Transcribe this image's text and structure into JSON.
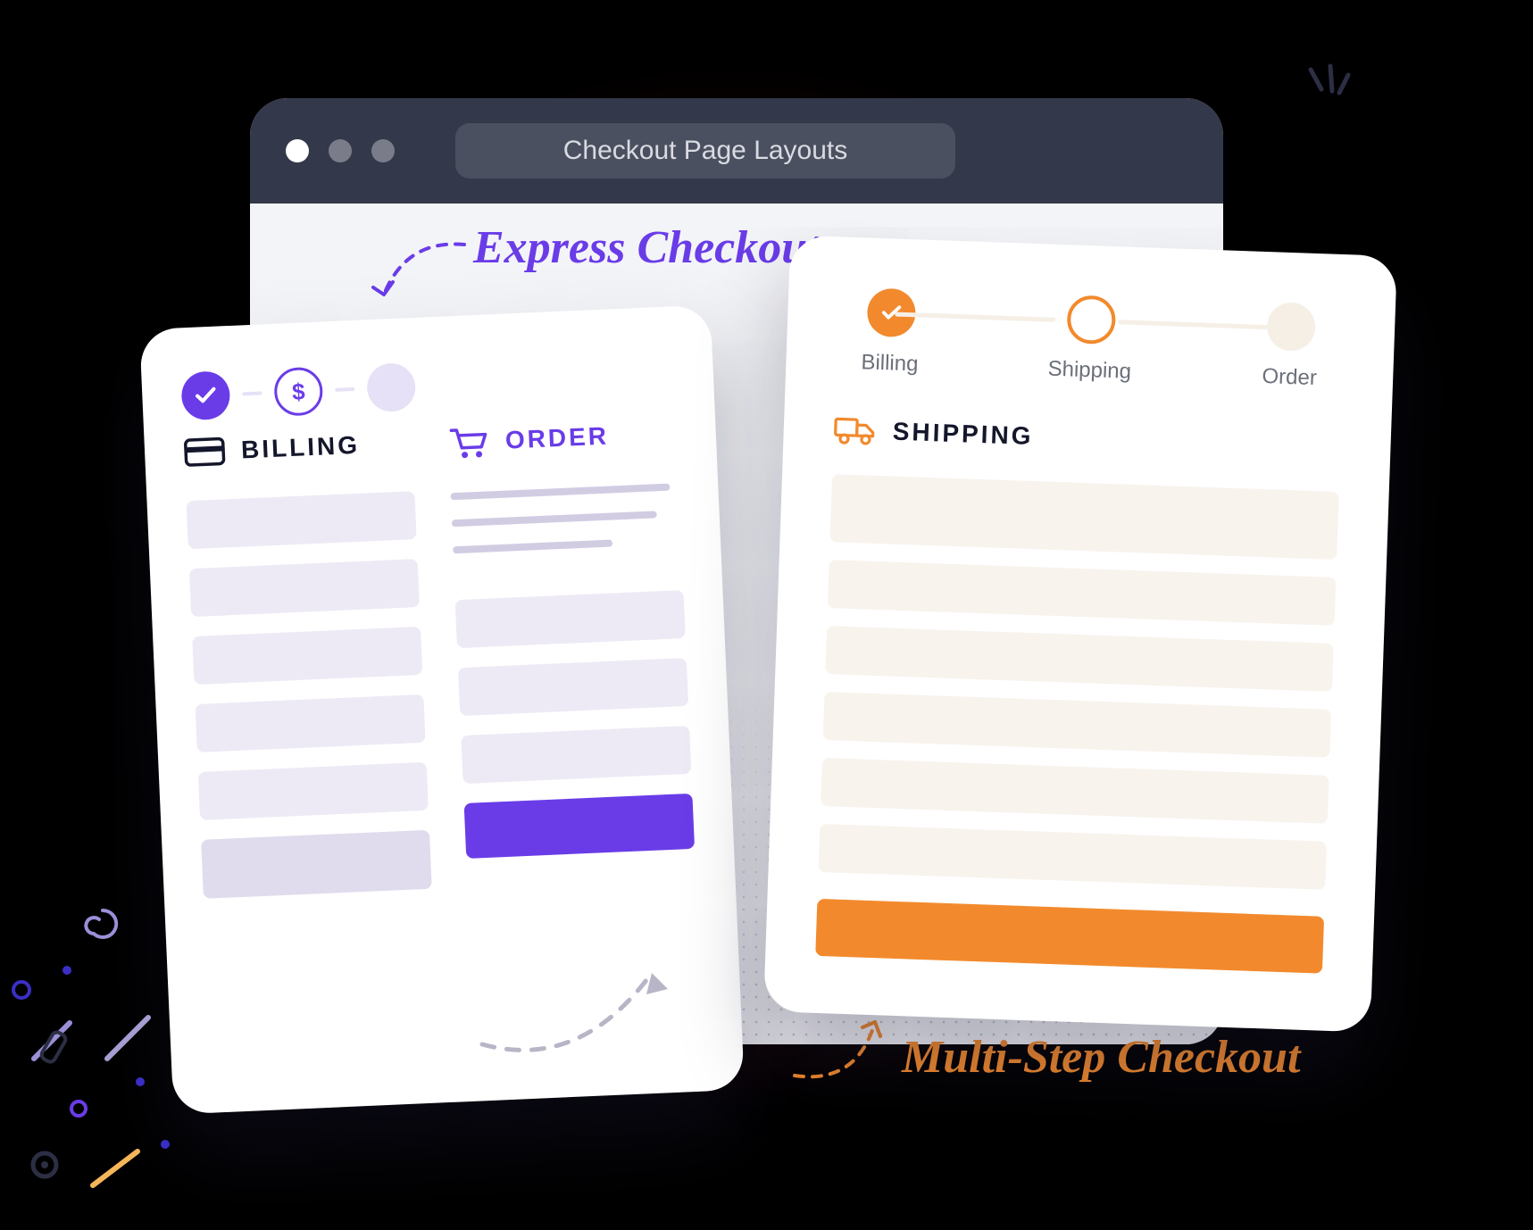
{
  "window": {
    "title": "Checkout Page Layouts"
  },
  "annotations": {
    "express": "Express Checkout",
    "multistep": "Multi-Step Checkout"
  },
  "express_card": {
    "billing_title": "BILLING",
    "order_title": "ORDER"
  },
  "multistep_card": {
    "steps": {
      "billing": "Billing",
      "shipping": "Shipping",
      "order": "Order"
    },
    "section_title": "SHIPPING"
  },
  "colors": {
    "purple": "#6a3ce8",
    "orange": "#f28a2d",
    "window_header": "#33384a"
  }
}
